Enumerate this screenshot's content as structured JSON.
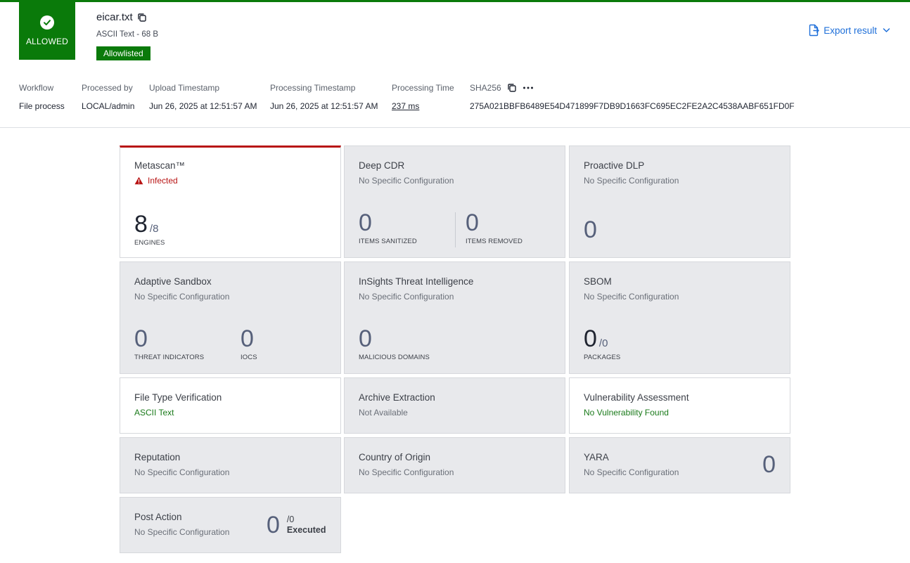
{
  "header": {
    "verdict": "ALLOWED",
    "file_name": "eicar.txt",
    "file_meta": "ASCII Text - 68 B",
    "badge": "Allowlisted",
    "export_label": "Export result"
  },
  "meta": {
    "workflow_label": "Workflow",
    "workflow_value": "File process",
    "processed_by_label": "Processed by",
    "processed_by_value": "LOCAL/admin",
    "upload_label": "Upload Timestamp",
    "upload_value": "Jun 26, 2025 at 12:51:57 AM",
    "processing_ts_label": "Processing Timestamp",
    "processing_ts_value": "Jun 26, 2025 at 12:51:57 AM",
    "processing_time_label": "Processing Time",
    "processing_time_value": "237 ms",
    "sha_label": "SHA256",
    "sha_value": "275A021BBFB6489E54D471899F7DB9D1663FC695EC2FE2A2C4538AABF651FD0F"
  },
  "cards": {
    "metascan": {
      "title": "Metascan™",
      "status": "Infected",
      "value": "8",
      "total": "/8",
      "caption": "ENGINES"
    },
    "deep_cdr": {
      "title": "Deep CDR",
      "subtitle": "No Specific Configuration",
      "v1": "0",
      "c1": "ITEMS SANITIZED",
      "v2": "0",
      "c2": "ITEMS REMOVED"
    },
    "proactive_dlp": {
      "title": "Proactive DLP",
      "subtitle": "No Specific Configuration",
      "value": "0"
    },
    "sandbox": {
      "title": "Adaptive Sandbox",
      "subtitle": "No Specific Configuration",
      "v1": "0",
      "c1": "THREAT INDICATORS",
      "v2": "0",
      "c2": "IOCS"
    },
    "insights": {
      "title": "InSights Threat Intelligence",
      "subtitle": "No Specific Configuration",
      "value": "0",
      "caption": "MALICIOUS DOMAINS"
    },
    "sbom": {
      "title": "SBOM",
      "subtitle": "No Specific Configuration",
      "value": "0",
      "total": "/0",
      "caption": "PACKAGES"
    },
    "ftv": {
      "title": "File Type Verification",
      "subtitle": "ASCII Text"
    },
    "archive": {
      "title": "Archive Extraction",
      "subtitle": "Not Available"
    },
    "vuln": {
      "title": "Vulnerability Assessment",
      "subtitle": "No Vulnerability Found"
    },
    "reputation": {
      "title": "Reputation",
      "subtitle": "No Specific Configuration"
    },
    "country": {
      "title": "Country of Origin",
      "subtitle": "No Specific Configuration"
    },
    "yara": {
      "title": "YARA",
      "subtitle": "No Specific Configuration",
      "value": "0"
    },
    "post_action": {
      "title": "Post Action",
      "subtitle": "No Specific Configuration",
      "value": "0",
      "total": "/0",
      "executed": "Executed"
    }
  },
  "colors": {
    "allowed": "#0a7a0a",
    "infected": "#b81414",
    "link": "#1e6fd9"
  }
}
